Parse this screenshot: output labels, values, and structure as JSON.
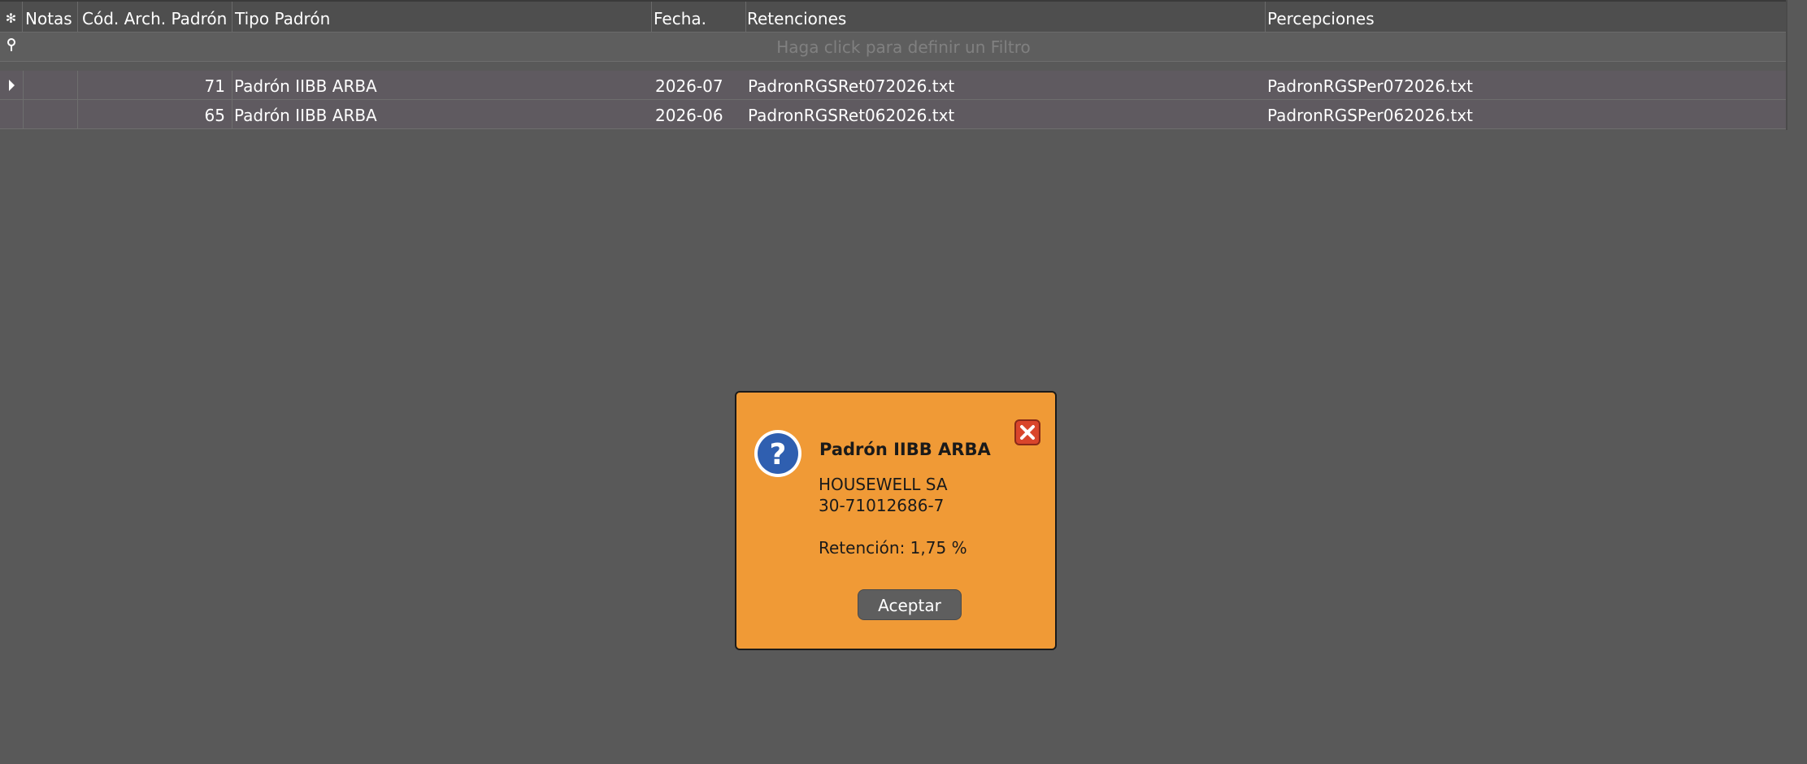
{
  "grid": {
    "header": {
      "sort_glyph": "✻",
      "notas": "Notas",
      "cod": "Cód. Arch. Padrón",
      "tipo": "Tipo Padrón",
      "fecha": "Fecha.",
      "retenciones": "Retenciones",
      "percepciones": "Percepciones"
    },
    "filter": {
      "icon": "pin-icon",
      "placeholder": "Haga click para definir un Filtro"
    },
    "rows": [
      {
        "cod": "71",
        "tipo": "Padrón IIBB ARBA",
        "fecha": "2026-07",
        "retenciones": "PadronRGSRet072026.txt",
        "percepciones": "PadronRGSPer072026.txt"
      },
      {
        "cod": "65",
        "tipo": "Padrón IIBB ARBA",
        "fecha": "2026-06",
        "retenciones": "PadronRGSRet062026.txt",
        "percepciones": "PadronRGSPer062026.txt"
      }
    ]
  },
  "dialog": {
    "icon": "question-icon",
    "close_icon": "close-icon",
    "title": "Padrón IIBB ARBA",
    "company": "HOUSEWELL SA",
    "cuit": "30-71012686-7",
    "retention": "Retención: 1,75 %",
    "ok_label": "Aceptar",
    "colors": {
      "background": "#f09a36",
      "button": "#5e5e5e",
      "close": "#d9452b",
      "icon": "#2f5fb0"
    }
  }
}
